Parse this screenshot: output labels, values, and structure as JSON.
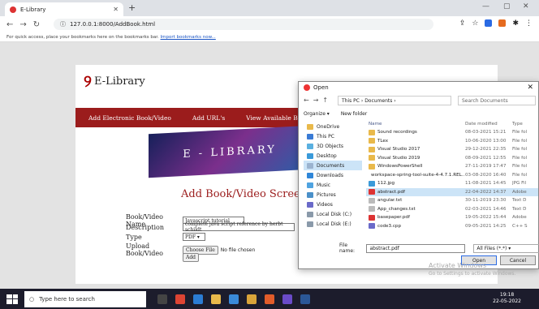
{
  "browser": {
    "tab_title": "E-Library",
    "url": "127.0.0.1:8000/AddBook.html",
    "bookmark_text": "For quick access, place your bookmarks here on the bookmarks bar.",
    "bookmark_link": "Import bookmarks now..."
  },
  "site": {
    "logo": "E-Library",
    "menu": [
      "Add Electronic Book/Video",
      "Add URL's",
      "View Available Book"
    ],
    "banner": "E - LIBRARY",
    "form_title": "Add Book/Video Screen"
  },
  "form": {
    "name_label": "Book/Video Name",
    "name_value": "Javascript tutorial",
    "desc_label": "Description",
    "desc_value": "complete java script reference by herbt schildt",
    "type_label": "Type",
    "type_value": "PDF",
    "upload_label": "Upload Book/Video",
    "choose_label": "Choose File",
    "no_file": "No file chosen",
    "add_label": "Add"
  },
  "dialog": {
    "title": "Open",
    "path": "This PC › Documents ›",
    "search_placeholder": "Search Documents",
    "organize": "Organize ▾",
    "new_folder": "New folder",
    "nav": [
      "OneDrive",
      "This PC",
      "3D Objects",
      "Desktop",
      "Documents",
      "Downloads",
      "Music",
      "Pictures",
      "Videos",
      "Local Disk (C:)",
      "Local Disk (E:)"
    ],
    "headers": [
      "Name",
      "Date modified",
      "Type"
    ],
    "files": [
      {
        "name": "Sound recordings",
        "date": "08-03-2021 15:21",
        "type": "File fol",
        "kind": "folder"
      },
      {
        "name": "TLex",
        "date": "10-06-2020 13:00",
        "type": "File fol",
        "kind": "folder"
      },
      {
        "name": "Visual Studio 2017",
        "date": "29-12-2021 22:35",
        "type": "File fol",
        "kind": "folder"
      },
      {
        "name": "Visual Studio 2019",
        "date": "08-09-2021 12:55",
        "type": "File fol",
        "kind": "folder"
      },
      {
        "name": "WindowsPowerShell",
        "date": "27-11-2019 17:47",
        "type": "File fol",
        "kind": "folder"
      },
      {
        "name": "workspace-spring-tool-suite-4-4.7.1.REL...",
        "date": "03-08-2020 16:40",
        "type": "File fol",
        "kind": "folder"
      },
      {
        "name": "112.jpg",
        "date": "11-08-2021 14:45",
        "type": "JPG Fil",
        "kind": "img"
      },
      {
        "name": "abstract.pdf",
        "date": "22-04-2022 14:37",
        "type": "Adobe",
        "kind": "pdf"
      },
      {
        "name": "angular.txt",
        "date": "30-11-2019 23:30",
        "type": "Text D",
        "kind": "txt"
      },
      {
        "name": "App_changes.txt",
        "date": "02-03-2021 14:46",
        "type": "Text D",
        "kind": "txt"
      },
      {
        "name": "basepaper.pdf",
        "date": "19-05-2022 15:44",
        "type": "Adobe",
        "kind": "pdf"
      },
      {
        "name": "code3.cpp",
        "date": "09-05-2021 14:25",
        "type": "C++ S",
        "kind": "cpp"
      }
    ],
    "filename_label": "File name:",
    "filename_value": "abstract.pdf",
    "filetype": "All Files (*.*)",
    "open": "Open",
    "cancel": "Cancel"
  },
  "watermark": {
    "line1": "Activate Windows",
    "line2": "Go to Settings to activate Windows."
  },
  "taskbar": {
    "search": "Type here to search",
    "time": "19:18",
    "date": "22-05-2022"
  },
  "colors": {
    "accent": "#9b1c1c",
    "selection": "#cce4f7"
  }
}
